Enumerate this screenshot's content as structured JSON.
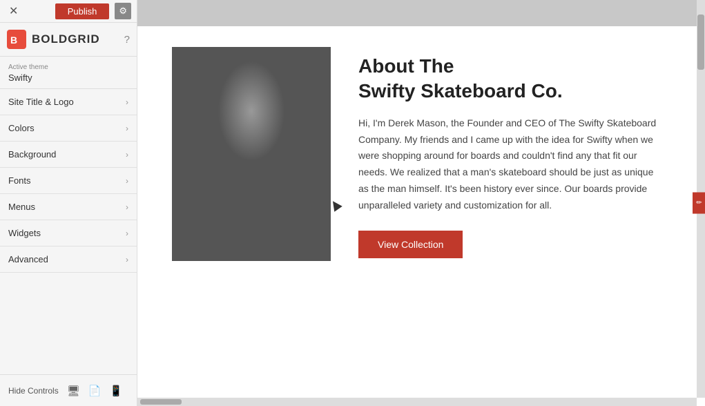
{
  "topBar": {
    "closeLabel": "✕",
    "publishLabel": "Publish",
    "gearLabel": "⚙"
  },
  "logo": {
    "iconColor": "#e74c3c",
    "text": "BOLDGRID",
    "helpLabel": "?"
  },
  "activeTheme": {
    "label": "Active theme",
    "name": "Swifty"
  },
  "navItems": [
    {
      "label": "Site Title & Logo",
      "id": "site-title-logo"
    },
    {
      "label": "Colors",
      "id": "colors"
    },
    {
      "label": "Background",
      "id": "background"
    },
    {
      "label": "Fonts",
      "id": "fonts"
    },
    {
      "label": "Menus",
      "id": "menus"
    },
    {
      "label": "Widgets",
      "id": "widgets"
    },
    {
      "label": "Advanced",
      "id": "advanced"
    }
  ],
  "bottomBar": {
    "hideControlsLabel": "Hide Controls",
    "icons": [
      "desktop-icon",
      "document-icon",
      "mobile-icon"
    ]
  },
  "preview": {
    "aboutTitle": "About The\nSwifty Skateboard Co.",
    "aboutBody": "Hi, I'm Derek Mason, the Founder and CEO of The Swifty Skateboard Company. My friends and I came up with the idea for Swifty when we were shopping around for boards and couldn't find any that fit our needs. We realized that a man's skateboard should be just as unique as the man himself. It's been history ever since. Our boards provide unparalleled variety and customization for all.",
    "viewCollectionLabel": "View Collection"
  }
}
